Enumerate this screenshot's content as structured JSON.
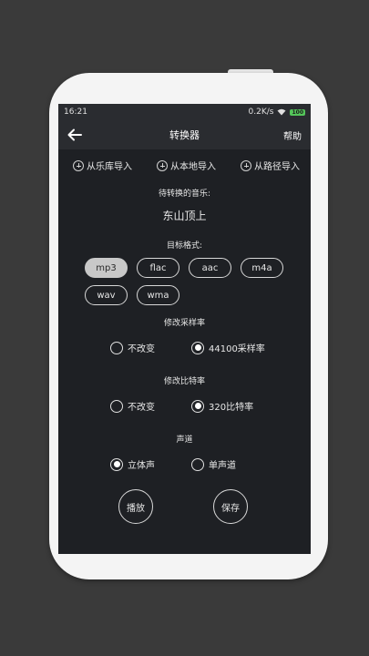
{
  "status_bar": {
    "time": "16:21",
    "speed": "0.2K/s",
    "battery": "100"
  },
  "app_bar": {
    "title": "转换器",
    "help": "帮助"
  },
  "imports": [
    {
      "label": "从乐库导入"
    },
    {
      "label": "从本地导入"
    },
    {
      "label": "从路径导入"
    }
  ],
  "pending": {
    "label": "待转换的音乐:",
    "song": "东山顶上"
  },
  "target_format": {
    "label": "目标格式:",
    "options": [
      "mp3",
      "flac",
      "aac",
      "m4a",
      "wav",
      "wma"
    ],
    "selected": "mp3"
  },
  "sample_rate": {
    "label": "修改采样率",
    "options": [
      {
        "label": "不改变",
        "checked": false
      },
      {
        "label": "44100采样率",
        "checked": true
      }
    ]
  },
  "bit_rate": {
    "label": "修改比特率",
    "options": [
      {
        "label": "不改变",
        "checked": false
      },
      {
        "label": "320比特率",
        "checked": true
      }
    ]
  },
  "channel": {
    "label": "声道",
    "options": [
      {
        "label": "立体声",
        "checked": true
      },
      {
        "label": "单声道",
        "checked": false
      }
    ]
  },
  "actions": {
    "play": "播放",
    "save": "保存"
  },
  "colors": {
    "screen_bg": "#1e2024",
    "bar_bg": "#2a2c30",
    "chip_selected": "#c8c8c8",
    "battery": "#54c55a"
  }
}
